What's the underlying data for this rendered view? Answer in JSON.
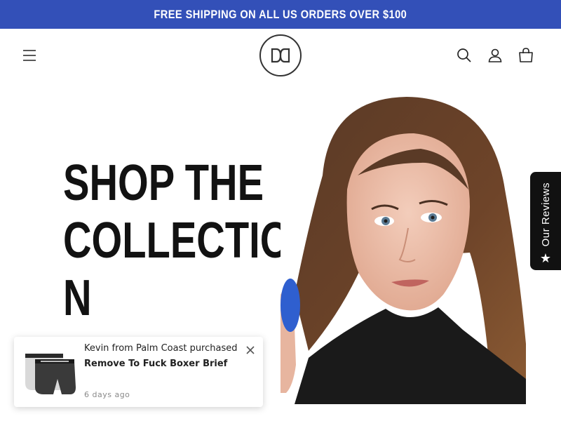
{
  "announcement": {
    "text": "FREE SHIPPING ON ALL US ORDERS OVER $100"
  },
  "header": {
    "icons": {
      "menu": "menu-icon",
      "logo": "brand-logo",
      "search": "search-icon",
      "account": "account-icon",
      "cart": "cart-icon"
    }
  },
  "hero": {
    "heading_lines": [
      "SHOP THE",
      "COLLECTIO",
      "N"
    ]
  },
  "reviews_tab": {
    "label": "Our Reviews",
    "icon": "star-icon"
  },
  "purchase_popup": {
    "buyer_text": "Kevin from Palm Coast purchased",
    "product_name": "Remove To Fuck Boxer Brief",
    "time_ago": "6 days ago",
    "close_icon": "close-icon"
  },
  "colors": {
    "announcement_bg": "#3350b8",
    "reviews_tab_bg": "#111111",
    "text": "#121212"
  }
}
